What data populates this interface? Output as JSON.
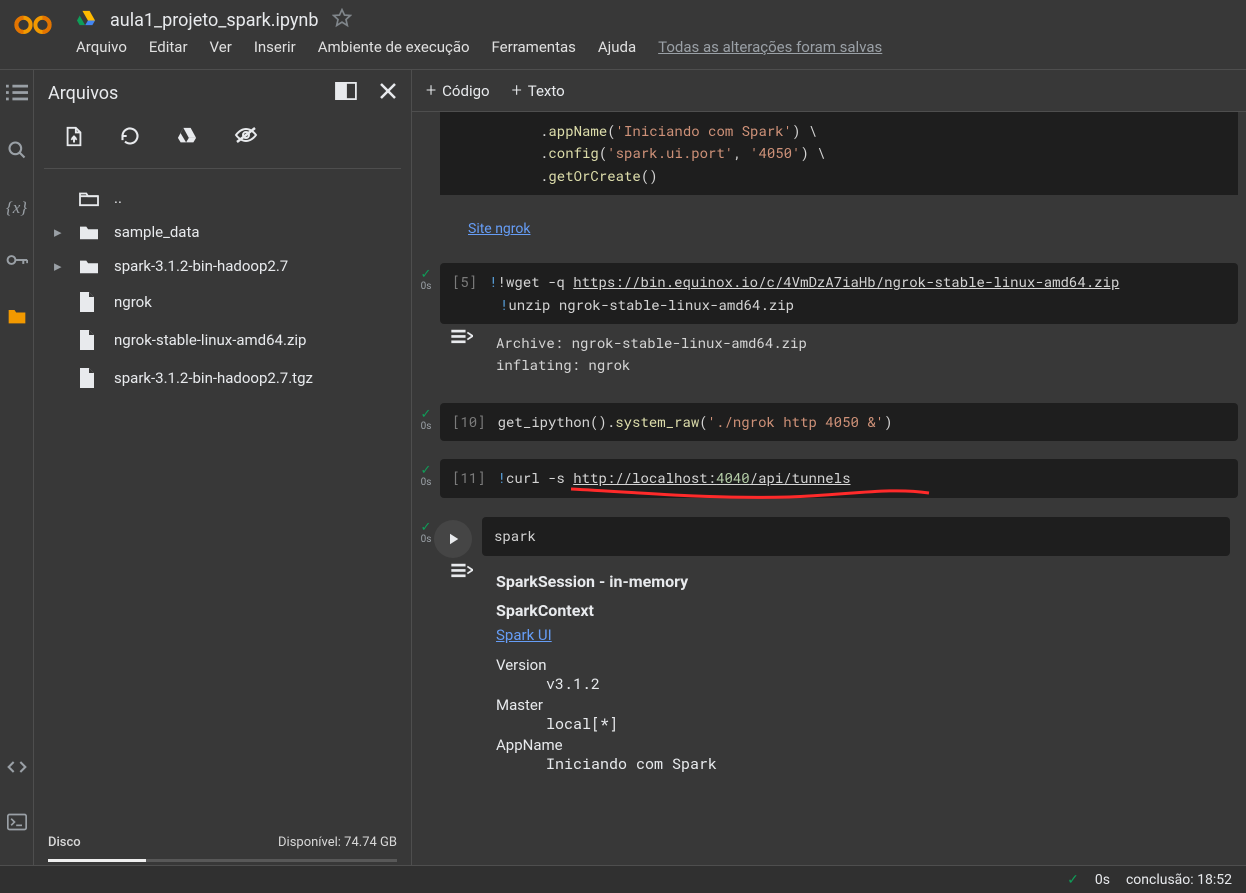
{
  "header": {
    "title": "aula1_projeto_spark.ipynb",
    "menu": [
      "Arquivo",
      "Editar",
      "Ver",
      "Inserir",
      "Ambiente de execução",
      "Ferramentas",
      "Ajuda"
    ],
    "save_status": "Todas as alterações foram salvas"
  },
  "files_panel": {
    "title": "Arquivos",
    "items": [
      {
        "type": "up",
        "label": ".."
      },
      {
        "type": "folder",
        "label": "sample_data",
        "expandable": true
      },
      {
        "type": "folder",
        "label": "spark-3.1.2-bin-hadoop2.7",
        "expandable": true
      },
      {
        "type": "file",
        "label": "ngrok"
      },
      {
        "type": "file",
        "label": "ngrok-stable-linux-amd64.zip"
      },
      {
        "type": "file",
        "label": "spark-3.1.2-bin-hadoop2.7.tgz"
      }
    ],
    "disk_label": "Disco",
    "disk_available": "Disponível: 74.74 GB"
  },
  "toolbar": {
    "code_btn": "Código",
    "text_btn": "Texto"
  },
  "cells": {
    "cell0_lines": [
      {
        "parts": [
          {
            "t": ".",
            "c": "p"
          },
          {
            "t": "config",
            "c": "fn"
          },
          {
            "t": "(",
            "c": "p"
          },
          {
            "t": "'spark.ui.port'",
            "c": "s"
          },
          {
            "t": ", ",
            "c": "p"
          },
          {
            "t": "'4050'",
            "c": "s"
          },
          {
            "t": ") \\",
            "c": "p"
          }
        ]
      },
      {
        "parts": [
          {
            "t": ".",
            "c": "p"
          },
          {
            "t": "getOrCreate",
            "c": "fn"
          },
          {
            "t": "()",
            "c": "p"
          }
        ]
      }
    ],
    "link_ngrok": "Site ngrok",
    "cell5": {
      "num": "[5]",
      "line1_head": "!wget -q ",
      "line1_url": "https://bin.equinox.io/c/4VmDzA7iaHb/ngrok-stable-linux-amd64.zip",
      "line2": "!unzip ngrok-stable-linux-amd64.zip",
      "out1": "Archive:  ngrok-stable-linux-amd64.zip",
      "out2": "  inflating: ngrok",
      "time": "0s"
    },
    "cell10": {
      "num": "[10]",
      "line": {
        "pre": "get_ipython().",
        "fn": "system_raw",
        "open": "(",
        "str": "'./ngrok http 4050 &'",
        "close": ")"
      },
      "time": "0s"
    },
    "cell11": {
      "num": "[11]",
      "line_head": "!curl -s ",
      "line_url_pre": "http://localhost:",
      "line_url_port": "4040",
      "line_url_post": "/api/tunnels",
      "time": "0s"
    },
    "cell12": {
      "code": "spark",
      "time": "0s",
      "out_title": "SparkSession - in-memory",
      "out_sub": "SparkContext",
      "out_link": "Spark UI",
      "rows": [
        {
          "k": "Version",
          "v": "v3.1.2"
        },
        {
          "k": "Master",
          "v": "local[*]"
        },
        {
          "k": "AppName",
          "v": "Iniciando com Spark"
        }
      ]
    }
  },
  "statusbar": {
    "time": "0s",
    "status": "conclusão: 18:52"
  }
}
